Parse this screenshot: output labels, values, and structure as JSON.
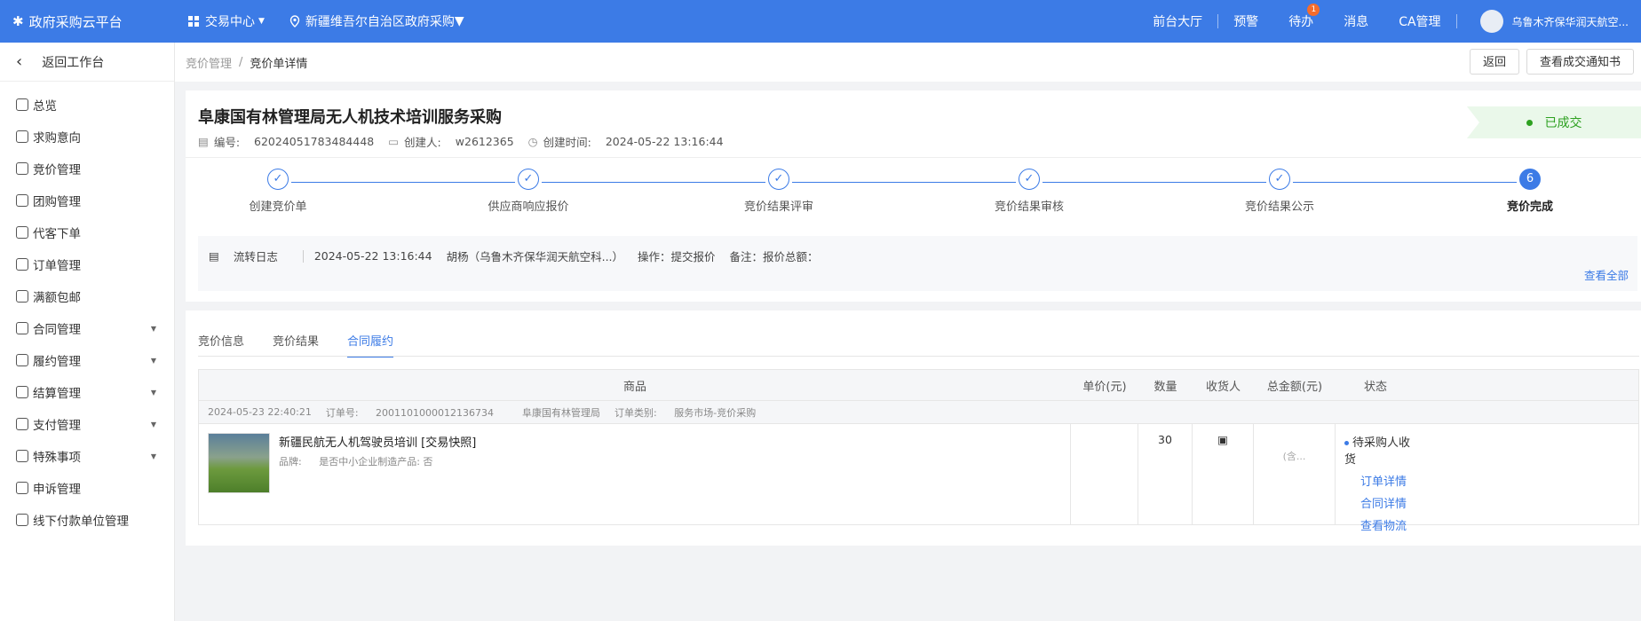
{
  "header": {
    "app_title": "政府采购云平台",
    "menu_label": "交易中心",
    "region": "新疆维吾尔自治区政府采购",
    "nav": [
      "前台大厅",
      "预警",
      "待办",
      "消息",
      "CA管理"
    ],
    "todo_badge": "1",
    "user": "乌鲁木齐保华润天航空..."
  },
  "sidebar": {
    "back_label": "返回工作台",
    "items": [
      {
        "label": "总览",
        "arrow": ""
      },
      {
        "label": "求购意向",
        "arrow": ""
      },
      {
        "label": "竞价管理",
        "arrow": ""
      },
      {
        "label": "团购管理",
        "arrow": ""
      },
      {
        "label": "代客下单",
        "arrow": ""
      },
      {
        "label": "订单管理",
        "arrow": ""
      },
      {
        "label": "满额包邮",
        "arrow": ""
      },
      {
        "label": "合同管理",
        "arrow": "▼"
      },
      {
        "label": "履约管理",
        "arrow": "▼"
      },
      {
        "label": "结算管理",
        "arrow": "▼"
      },
      {
        "label": "支付管理",
        "arrow": "▼"
      },
      {
        "label": "特殊事项",
        "arrow": "▼"
      },
      {
        "label": "申诉管理",
        "arrow": ""
      },
      {
        "label": "线下付款单位管理",
        "arrow": ""
      }
    ]
  },
  "breadcrumb": {
    "parent": "竞价管理",
    "current": "竞价单详情",
    "sep": "/"
  },
  "actions": {
    "back": "返回",
    "notice": "查看成交通知书"
  },
  "detail": {
    "title": "阜康国有林管理局无人机技术培训服务采购",
    "number_label": "编号:",
    "number": "62024051783484448",
    "creator_label": "创建人:",
    "creator": "w2612365",
    "created_label": "创建时间:",
    "created": "2024-05-22 13:16:44",
    "status": "已成交"
  },
  "steps": [
    {
      "label": "创建竞价单",
      "mark": "✓"
    },
    {
      "label": "供应商响应报价",
      "mark": "✓"
    },
    {
      "label": "竞价结果评审",
      "mark": "✓"
    },
    {
      "label": "竞价结果审核",
      "mark": "✓"
    },
    {
      "label": "竞价结果公示",
      "mark": "✓"
    },
    {
      "label": "竞价完成",
      "mark": "6"
    }
  ],
  "flow": {
    "label": "流转日志",
    "time": "2024-05-22 13:16:44",
    "who": "胡杨（乌鲁木齐保华润天航空科...）",
    "op": "操作：提交报价",
    "remark": "备注：报价总额：",
    "more": "查看全部"
  },
  "tabs": [
    "竞价信息",
    "竞价结果",
    "合同履约"
  ],
  "table": {
    "headers": [
      "商品",
      "单价(元)",
      "数量",
      "收货人",
      "总金额(元)",
      "状态"
    ],
    "order": {
      "time": "2024-05-23 22:40:21",
      "no_label": "订单号:",
      "no": "2001101000012136734",
      "buyer": "阜康国有林管理局",
      "type_label": "订单类别:",
      "type": "服务市场-竞价采购"
    },
    "row": {
      "name": "新疆民航无人机驾驶员培训 [交易快照]",
      "brand_label": "品牌:",
      "sme": "是否中小企业制造产品: 否",
      "qty": "30",
      "amount_note": "(含...",
      "status": "待采购人收货",
      "links": [
        "订单详情",
        "合同详情",
        "查看物流"
      ]
    }
  },
  "colors": {
    "primary": "#3c7be6",
    "success": "#2ea121"
  }
}
